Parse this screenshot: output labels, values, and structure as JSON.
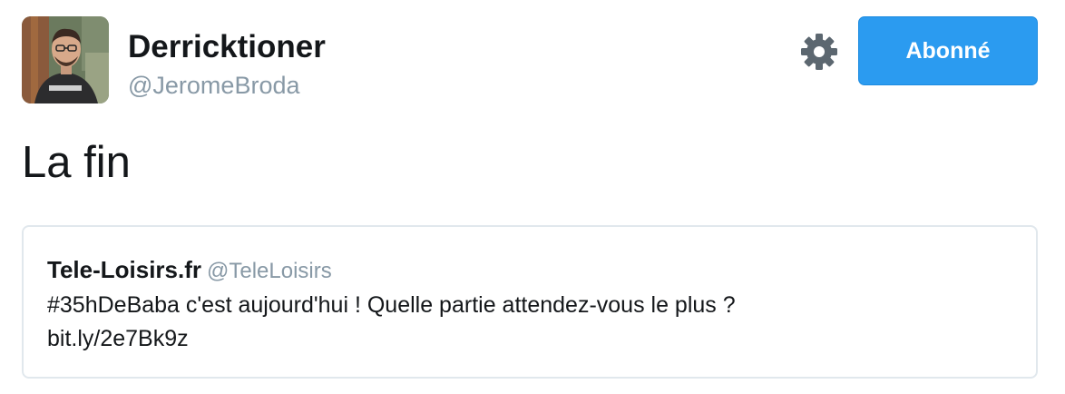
{
  "tweet": {
    "author": {
      "display_name": "Derricktioner",
      "handle": "@JeromeBroda",
      "avatar_icon": "user-avatar-photo"
    },
    "settings_icon": "gear-icon",
    "follow_button_label": "Abonné",
    "text": "La fin",
    "quoted": {
      "name": "Tele-Loisirs.fr",
      "handle": "@TeleLoisirs",
      "text_line1": "#35hDeBaba c'est aujourd'hui ! Quelle partie attendez-vous le plus ?",
      "link": "bit.ly/2e7Bk9z"
    }
  },
  "colors": {
    "accent": "#2b9bf0",
    "text": "#14171a",
    "muted": "#8899a6",
    "border": "#e1e8ed",
    "gear": "#5c6770"
  }
}
